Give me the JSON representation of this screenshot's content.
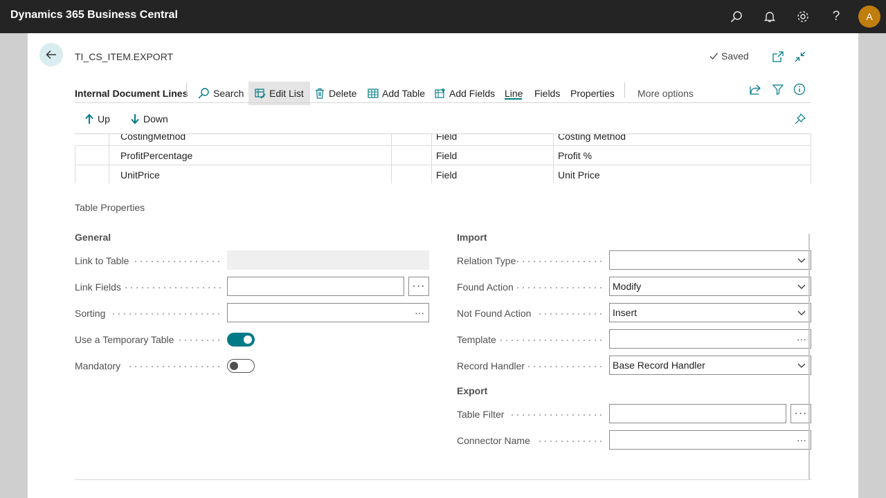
{
  "app": {
    "title": "Dynamics 365 Business Central",
    "avatar_initial": "A"
  },
  "header": {
    "document_title": "TI_CS_ITEM.EXPORT",
    "saved_label": "Saved"
  },
  "action_bar": {
    "title": "Internal Document Lines",
    "items": [
      {
        "label": "Search",
        "icon": "search-icon"
      },
      {
        "label": "Edit List",
        "icon": "edit-list-icon"
      },
      {
        "label": "Delete",
        "icon": "delete-icon"
      },
      {
        "label": "Add Table",
        "icon": "table-icon"
      },
      {
        "label": "Add Fields",
        "icon": "add-fields-icon"
      },
      {
        "label": "Line"
      },
      {
        "label": "Fields"
      },
      {
        "label": "Properties"
      },
      {
        "label": "More options"
      }
    ],
    "active_tab": "Line"
  },
  "sub_actions": {
    "up": "Up",
    "down": "Down"
  },
  "grid": {
    "rows": [
      {
        "name": "CostingMethod",
        "type": "Field",
        "caption": "Costing Method"
      },
      {
        "name": "ProfitPercentage",
        "type": "Field",
        "caption": "Profit %"
      },
      {
        "name": "UnitPrice",
        "type": "Field",
        "caption": "Unit Price"
      }
    ]
  },
  "table_properties": {
    "title": "Table Properties",
    "general": {
      "title": "General",
      "link_to_table": {
        "label": "Link to Table",
        "value": ""
      },
      "link_fields": {
        "label": "Link Fields",
        "value": ""
      },
      "sorting": {
        "label": "Sorting",
        "value": ""
      },
      "use_temporary_table": {
        "label": "Use a Temporary Table",
        "value": true
      },
      "mandatory": {
        "label": "Mandatory",
        "value": false
      }
    },
    "import": {
      "title": "Import",
      "relation_type": {
        "label": "Relation Type",
        "value": ""
      },
      "found_action": {
        "label": "Found Action",
        "value": "Modify"
      },
      "not_found_action": {
        "label": "Not Found Action",
        "value": "Insert"
      },
      "template": {
        "label": "Template",
        "value": ""
      },
      "record_handler": {
        "label": "Record Handler",
        "value": "Base Record Handler"
      }
    },
    "export": {
      "title": "Export",
      "table_filter": {
        "label": "Table Filter",
        "value": ""
      },
      "connector_name": {
        "label": "Connector Name",
        "value": ""
      }
    }
  },
  "colors": {
    "accent": "#007a87",
    "topbar": "#242424",
    "avatar": "#c07e0d"
  }
}
